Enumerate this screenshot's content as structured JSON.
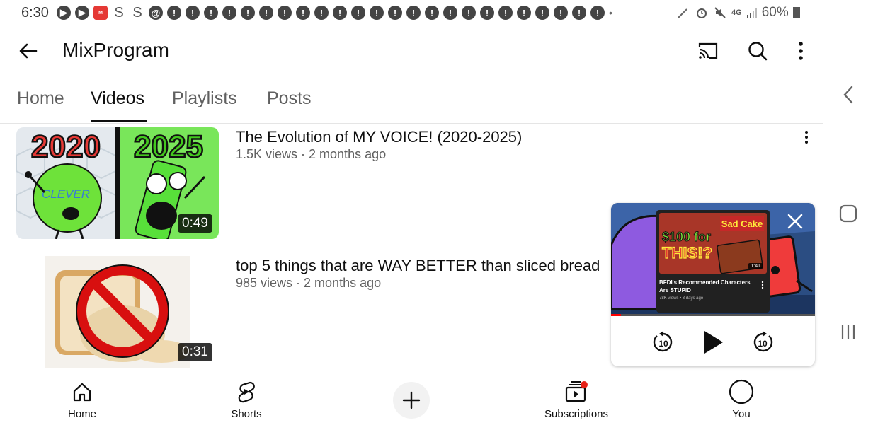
{
  "status_bar": {
    "time": "6:30",
    "battery": "60%",
    "network": "4G"
  },
  "header": {
    "channel_name": "MixProgram",
    "icons": [
      "back-arrow-icon",
      "cast-icon",
      "search-icon",
      "more-vert-icon"
    ]
  },
  "tabs": [
    {
      "label": "Home",
      "active": false
    },
    {
      "label": "Videos",
      "active": true
    },
    {
      "label": "Playlists",
      "active": false
    },
    {
      "label": "Posts",
      "active": false
    }
  ],
  "videos": [
    {
      "title": "The Evolution of MY VOICE! (2020-2025)",
      "meta": "1.5K views · 2 months ago",
      "duration": "0:49",
      "thumb_text_left": "2020",
      "thumb_text_right": "2025",
      "thumb_sign": "CLEVER"
    },
    {
      "title": "top 5 things that are WAY BETTER than sliced bread",
      "meta": "985 views · 2 months ago",
      "duration": "0:31"
    }
  ],
  "miniplayer": {
    "inner_video_title": "BFDI's Recommended Characters Are STUPID",
    "inner_video_meta": "78K views • 3 days ago",
    "inner_duration": "1:41",
    "inner_badge": "Sad Cake",
    "inner_price_text": "$100 for",
    "inner_this_text": "THIS!?",
    "progress": 0.05,
    "rewind_seconds": "10",
    "forward_seconds": "10"
  },
  "bottom_nav": [
    {
      "label": "Home",
      "icon": "home-icon"
    },
    {
      "label": "Shorts",
      "icon": "shorts-icon"
    },
    {
      "label": "",
      "icon": "create-plus-icon"
    },
    {
      "label": "Subscriptions",
      "icon": "subscriptions-icon"
    },
    {
      "label": "You",
      "icon": "you-avatar-icon"
    }
  ],
  "colors": {
    "accent_red": "#ff0000",
    "text_primary": "#0f0f0f",
    "text_secondary": "#606060"
  }
}
